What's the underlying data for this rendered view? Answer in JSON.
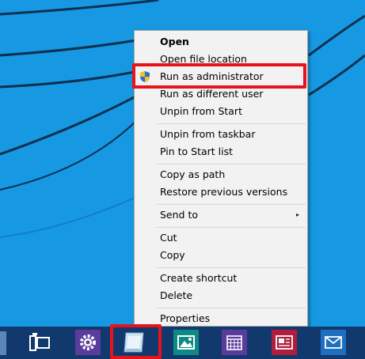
{
  "desktop": {
    "background": "#1798e2",
    "accent": "#e8121c"
  },
  "context_menu": {
    "items": [
      {
        "label": "Open",
        "bold": true
      },
      {
        "label": "Open file location"
      },
      {
        "label": "Run as administrator",
        "icon": "uac-shield-icon"
      },
      {
        "label": "Run as different user"
      },
      {
        "label": "Unpin from Start"
      },
      {
        "label": "Unpin from taskbar"
      },
      {
        "label": "Pin to Start list"
      },
      {
        "label": "Copy as path"
      },
      {
        "label": "Restore previous versions"
      },
      {
        "label": "Send to",
        "submenu": true
      },
      {
        "label": "Cut"
      },
      {
        "label": "Copy"
      },
      {
        "label": "Create shortcut"
      },
      {
        "label": "Delete"
      },
      {
        "label": "Properties"
      }
    ],
    "submenu_arrow": "▸"
  },
  "taskbar": {
    "color": "#11396e",
    "icons": [
      "task-view-icon",
      "settings-gear-icon",
      "app-shortcut-icon",
      "photos-icon",
      "calendar-icon",
      "news-icon",
      "mail-icon"
    ]
  }
}
